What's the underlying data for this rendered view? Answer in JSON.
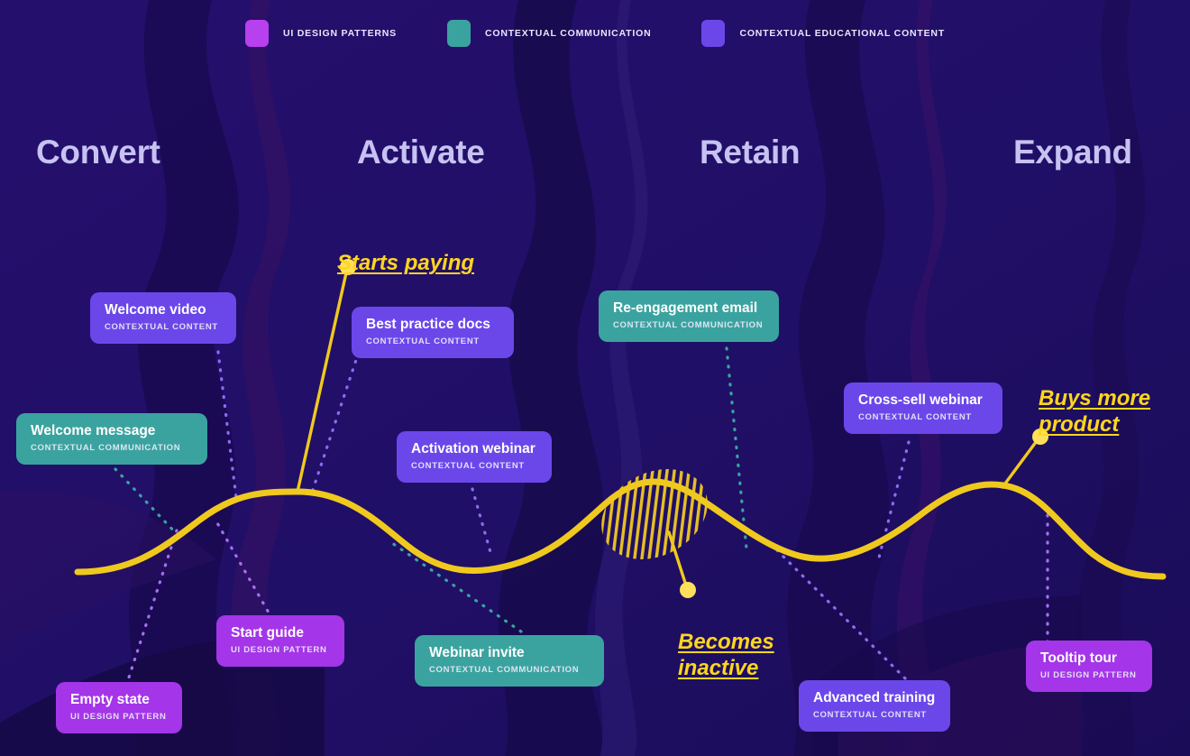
{
  "palette": {
    "background": "#200f66",
    "pattern": "#a435e8",
    "communication": "#3aa39f",
    "content": "#6b47ea",
    "curve": "#f0c91e",
    "milestone": "#ffd61e",
    "stage_title": "#c6c2f2"
  },
  "legend": {
    "items": [
      {
        "label": "UI DESIGN PATTERNS",
        "color": "#b740ef",
        "swatch": "legend-swatch-pattern"
      },
      {
        "label": "CONTEXTUAL COMMUNICATION",
        "color": "#3aa39f",
        "swatch": "legend-swatch-communication"
      },
      {
        "label": "CONTEXTUAL EDUCATIONAL CONTENT",
        "color": "#6b47ea",
        "swatch": "legend-swatch-content"
      }
    ]
  },
  "stages": [
    {
      "label": "Convert"
    },
    {
      "label": "Activate"
    },
    {
      "label": "Retain"
    },
    {
      "label": "Expand"
    }
  ],
  "milestones": [
    {
      "label": "Starts paying"
    },
    {
      "label": "Becomes\ninactive"
    },
    {
      "label": "Buys more\nproduct"
    }
  ],
  "cards": [
    {
      "title": "Welcome video",
      "subtitle": "CONTEXTUAL CONTENT",
      "category": "content"
    },
    {
      "title": "Welcome message",
      "subtitle": "CONTEXTUAL COMMUNICATION",
      "category": "communication"
    },
    {
      "title": "Empty state",
      "subtitle": "UI DESIGN PATTERN",
      "category": "pattern"
    },
    {
      "title": "Start guide",
      "subtitle": "UI DESIGN PATTERN",
      "category": "pattern"
    },
    {
      "title": "Best practice docs",
      "subtitle": "CONTEXTUAL CONTENT",
      "category": "content"
    },
    {
      "title": "Activation webinar",
      "subtitle": "CONTEXTUAL CONTENT",
      "category": "content"
    },
    {
      "title": "Webinar invite",
      "subtitle": "CONTEXTUAL COMMUNICATION",
      "category": "communication"
    },
    {
      "title": "Re-engagement email",
      "subtitle": "CONTEXTUAL COMMUNICATION",
      "category": "communication"
    },
    {
      "title": "Cross-sell webinar",
      "subtitle": "CONTEXTUAL CONTENT",
      "category": "content"
    },
    {
      "title": "Advanced training",
      "subtitle": "CONTEXTUAL CONTENT",
      "category": "content"
    },
    {
      "title": "Tooltip tour",
      "subtitle": "UI DESIGN PATTERN",
      "category": "pattern"
    }
  ]
}
